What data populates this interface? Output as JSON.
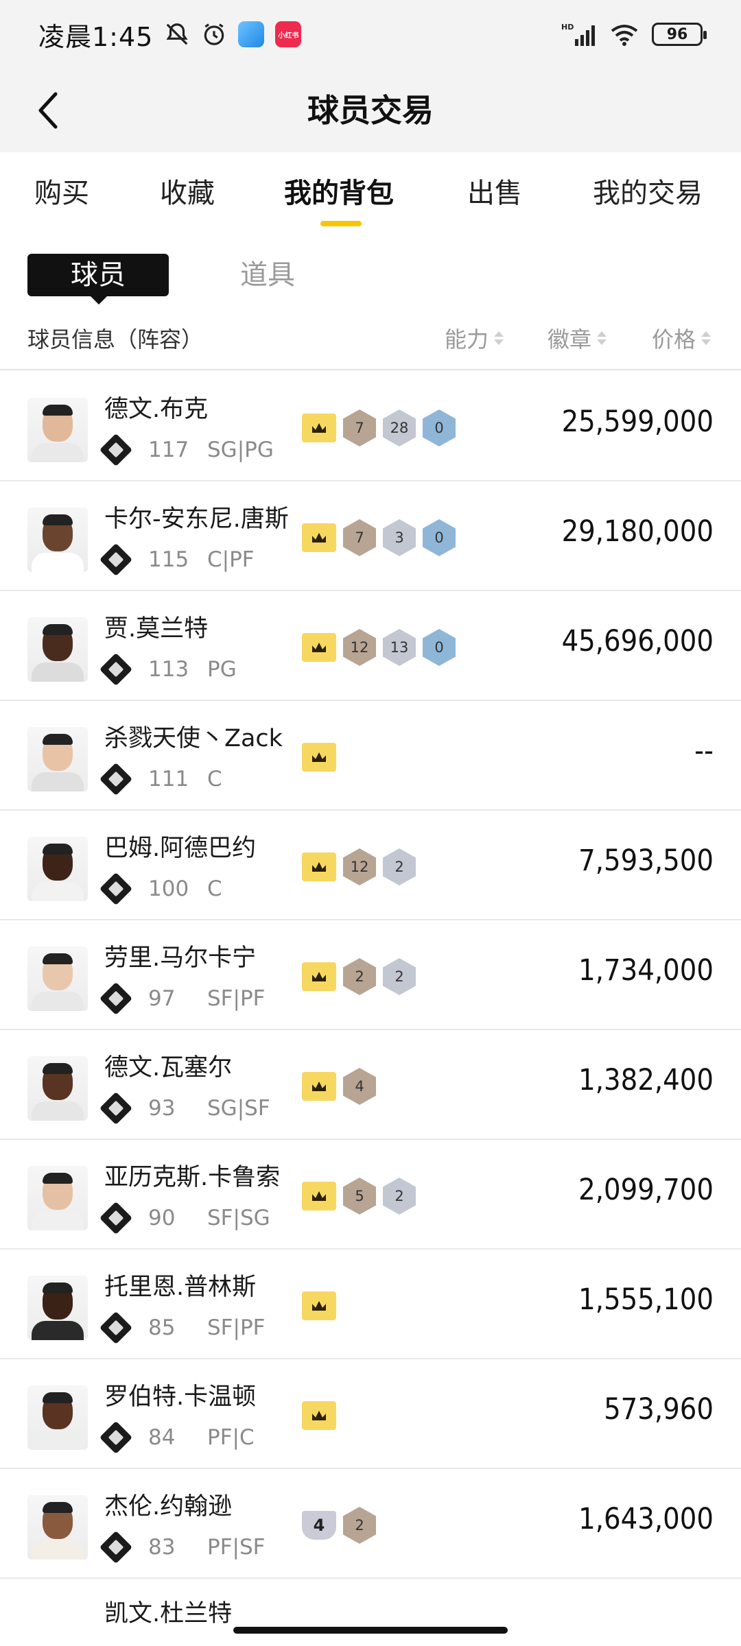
{
  "status_bar": {
    "time": "凌晨1:45",
    "battery": "96",
    "red_app_label": "小红书"
  },
  "header": {
    "title": "球员交易"
  },
  "tabs": [
    {
      "label": "购买"
    },
    {
      "label": "收藏"
    },
    {
      "label": "我的背包"
    },
    {
      "label": "出售"
    },
    {
      "label": "我的交易"
    }
  ],
  "segment": {
    "active": "球员",
    "other": "道具"
  },
  "columns": {
    "info": "球员信息（阵容）",
    "ability": "能力",
    "badge": "徽章",
    "price": "价格"
  },
  "players": [
    {
      "name": "德文.布克",
      "ovr": "117",
      "pos": "SG|PG",
      "badges": [
        "7",
        "28",
        "0"
      ],
      "price": "25,599,000"
    },
    {
      "name": "卡尔-安东尼.唐斯",
      "ovr": "115",
      "pos": "C|PF",
      "badges": [
        "7",
        "3",
        "0"
      ],
      "price": "29,180,000"
    },
    {
      "name": "贾.莫兰特",
      "ovr": "113",
      "pos": "PG",
      "badges": [
        "12",
        "13",
        "0"
      ],
      "price": "45,696,000"
    },
    {
      "name": "杀戮天使丶Zack",
      "ovr": "111",
      "pos": "C",
      "badges": [],
      "price": "--"
    },
    {
      "name": "巴姆.阿德巴约",
      "ovr": "100",
      "pos": "C",
      "badges": [
        "12",
        "2"
      ],
      "price": "7,593,500"
    },
    {
      "name": "劳里.马尔卡宁",
      "ovr": "97",
      "pos": "SF|PF",
      "badges": [
        "2",
        "2"
      ],
      "price": "1,734,000"
    },
    {
      "name": "德文.瓦塞尔",
      "ovr": "93",
      "pos": "SG|SF",
      "badges": [
        "4"
      ],
      "price": "1,382,400"
    },
    {
      "name": "亚历克斯.卡鲁索",
      "ovr": "90",
      "pos": "SF|SG",
      "badges": [
        "5",
        "2"
      ],
      "price": "2,099,700"
    },
    {
      "name": "托里恩.普林斯",
      "ovr": "85",
      "pos": "SF|PF",
      "badges": [],
      "price": "1,555,100"
    },
    {
      "name": "罗伯特.卡温顿",
      "ovr": "84",
      "pos": "PF|C",
      "badges": [],
      "price": "573,960"
    },
    {
      "name": "杰伦.约翰逊",
      "ovr": "83",
      "pos": "PF|SF",
      "special": "4",
      "badges": [
        "2"
      ],
      "price": "1,643,000"
    }
  ],
  "partial_row_name": "凯文.杜兰特"
}
